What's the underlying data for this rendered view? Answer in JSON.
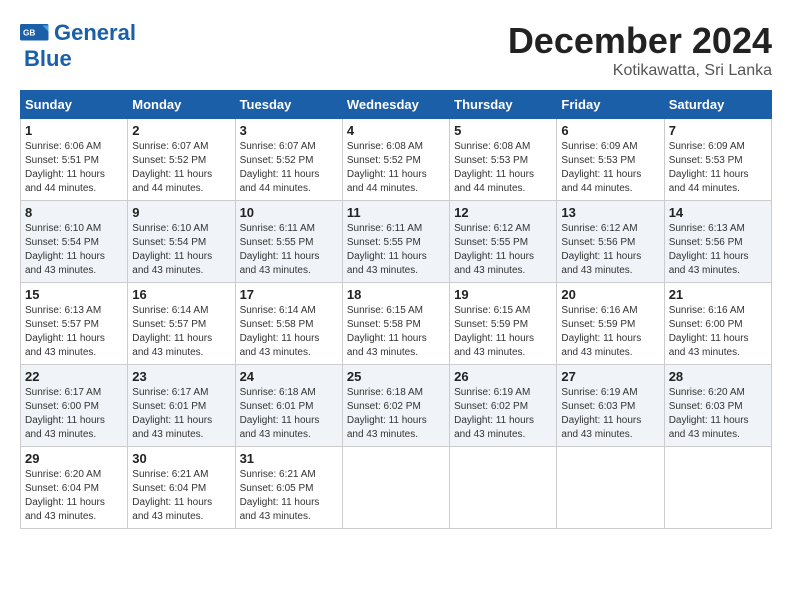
{
  "header": {
    "logo_line1": "General",
    "logo_line2": "Blue",
    "month_title": "December 2024",
    "location": "Kotikawatta, Sri Lanka"
  },
  "weekdays": [
    "Sunday",
    "Monday",
    "Tuesday",
    "Wednesday",
    "Thursday",
    "Friday",
    "Saturday"
  ],
  "weeks": [
    [
      {
        "day": "1",
        "sunrise": "6:06 AM",
        "sunset": "5:51 PM",
        "daylight": "11 hours and 44 minutes."
      },
      {
        "day": "2",
        "sunrise": "6:07 AM",
        "sunset": "5:52 PM",
        "daylight": "11 hours and 44 minutes."
      },
      {
        "day": "3",
        "sunrise": "6:07 AM",
        "sunset": "5:52 PM",
        "daylight": "11 hours and 44 minutes."
      },
      {
        "day": "4",
        "sunrise": "6:08 AM",
        "sunset": "5:52 PM",
        "daylight": "11 hours and 44 minutes."
      },
      {
        "day": "5",
        "sunrise": "6:08 AM",
        "sunset": "5:53 PM",
        "daylight": "11 hours and 44 minutes."
      },
      {
        "day": "6",
        "sunrise": "6:09 AM",
        "sunset": "5:53 PM",
        "daylight": "11 hours and 44 minutes."
      },
      {
        "day": "7",
        "sunrise": "6:09 AM",
        "sunset": "5:53 PM",
        "daylight": "11 hours and 44 minutes."
      }
    ],
    [
      {
        "day": "8",
        "sunrise": "6:10 AM",
        "sunset": "5:54 PM",
        "daylight": "11 hours and 43 minutes."
      },
      {
        "day": "9",
        "sunrise": "6:10 AM",
        "sunset": "5:54 PM",
        "daylight": "11 hours and 43 minutes."
      },
      {
        "day": "10",
        "sunrise": "6:11 AM",
        "sunset": "5:55 PM",
        "daylight": "11 hours and 43 minutes."
      },
      {
        "day": "11",
        "sunrise": "6:11 AM",
        "sunset": "5:55 PM",
        "daylight": "11 hours and 43 minutes."
      },
      {
        "day": "12",
        "sunrise": "6:12 AM",
        "sunset": "5:55 PM",
        "daylight": "11 hours and 43 minutes."
      },
      {
        "day": "13",
        "sunrise": "6:12 AM",
        "sunset": "5:56 PM",
        "daylight": "11 hours and 43 minutes."
      },
      {
        "day": "14",
        "sunrise": "6:13 AM",
        "sunset": "5:56 PM",
        "daylight": "11 hours and 43 minutes."
      }
    ],
    [
      {
        "day": "15",
        "sunrise": "6:13 AM",
        "sunset": "5:57 PM",
        "daylight": "11 hours and 43 minutes."
      },
      {
        "day": "16",
        "sunrise": "6:14 AM",
        "sunset": "5:57 PM",
        "daylight": "11 hours and 43 minutes."
      },
      {
        "day": "17",
        "sunrise": "6:14 AM",
        "sunset": "5:58 PM",
        "daylight": "11 hours and 43 minutes."
      },
      {
        "day": "18",
        "sunrise": "6:15 AM",
        "sunset": "5:58 PM",
        "daylight": "11 hours and 43 minutes."
      },
      {
        "day": "19",
        "sunrise": "6:15 AM",
        "sunset": "5:59 PM",
        "daylight": "11 hours and 43 minutes."
      },
      {
        "day": "20",
        "sunrise": "6:16 AM",
        "sunset": "5:59 PM",
        "daylight": "11 hours and 43 minutes."
      },
      {
        "day": "21",
        "sunrise": "6:16 AM",
        "sunset": "6:00 PM",
        "daylight": "11 hours and 43 minutes."
      }
    ],
    [
      {
        "day": "22",
        "sunrise": "6:17 AM",
        "sunset": "6:00 PM",
        "daylight": "11 hours and 43 minutes."
      },
      {
        "day": "23",
        "sunrise": "6:17 AM",
        "sunset": "6:01 PM",
        "daylight": "11 hours and 43 minutes."
      },
      {
        "day": "24",
        "sunrise": "6:18 AM",
        "sunset": "6:01 PM",
        "daylight": "11 hours and 43 minutes."
      },
      {
        "day": "25",
        "sunrise": "6:18 AM",
        "sunset": "6:02 PM",
        "daylight": "11 hours and 43 minutes."
      },
      {
        "day": "26",
        "sunrise": "6:19 AM",
        "sunset": "6:02 PM",
        "daylight": "11 hours and 43 minutes."
      },
      {
        "day": "27",
        "sunrise": "6:19 AM",
        "sunset": "6:03 PM",
        "daylight": "11 hours and 43 minutes."
      },
      {
        "day": "28",
        "sunrise": "6:20 AM",
        "sunset": "6:03 PM",
        "daylight": "11 hours and 43 minutes."
      }
    ],
    [
      {
        "day": "29",
        "sunrise": "6:20 AM",
        "sunset": "6:04 PM",
        "daylight": "11 hours and 43 minutes."
      },
      {
        "day": "30",
        "sunrise": "6:21 AM",
        "sunset": "6:04 PM",
        "daylight": "11 hours and 43 minutes."
      },
      {
        "day": "31",
        "sunrise": "6:21 AM",
        "sunset": "6:05 PM",
        "daylight": "11 hours and 43 minutes."
      },
      null,
      null,
      null,
      null
    ]
  ],
  "labels": {
    "sunrise": "Sunrise:",
    "sunset": "Sunset:",
    "daylight": "Daylight:"
  }
}
